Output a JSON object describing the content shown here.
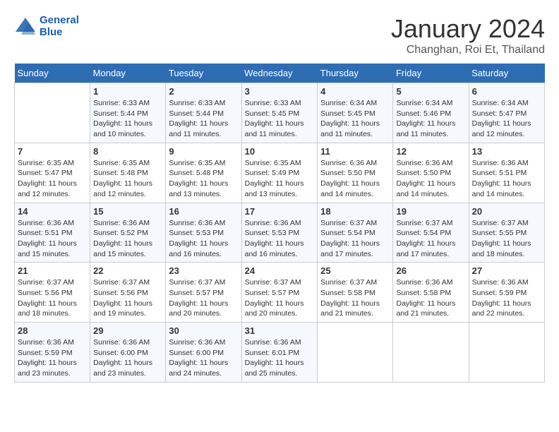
{
  "header": {
    "logo_line1": "General",
    "logo_line2": "Blue",
    "month": "January 2024",
    "location": "Changhan, Roi Et, Thailand"
  },
  "weekdays": [
    "Sunday",
    "Monday",
    "Tuesday",
    "Wednesday",
    "Thursday",
    "Friday",
    "Saturday"
  ],
  "weeks": [
    [
      {
        "num": "",
        "info": ""
      },
      {
        "num": "1",
        "info": "Sunrise: 6:33 AM\nSunset: 5:44 PM\nDaylight: 11 hours\nand 10 minutes."
      },
      {
        "num": "2",
        "info": "Sunrise: 6:33 AM\nSunset: 5:44 PM\nDaylight: 11 hours\nand 11 minutes."
      },
      {
        "num": "3",
        "info": "Sunrise: 6:33 AM\nSunset: 5:45 PM\nDaylight: 11 hours\nand 11 minutes."
      },
      {
        "num": "4",
        "info": "Sunrise: 6:34 AM\nSunset: 5:45 PM\nDaylight: 11 hours\nand 11 minutes."
      },
      {
        "num": "5",
        "info": "Sunrise: 6:34 AM\nSunset: 5:46 PM\nDaylight: 11 hours\nand 11 minutes."
      },
      {
        "num": "6",
        "info": "Sunrise: 6:34 AM\nSunset: 5:47 PM\nDaylight: 11 hours\nand 12 minutes."
      }
    ],
    [
      {
        "num": "7",
        "info": "Sunrise: 6:35 AM\nSunset: 5:47 PM\nDaylight: 11 hours\nand 12 minutes."
      },
      {
        "num": "8",
        "info": "Sunrise: 6:35 AM\nSunset: 5:48 PM\nDaylight: 11 hours\nand 12 minutes."
      },
      {
        "num": "9",
        "info": "Sunrise: 6:35 AM\nSunset: 5:48 PM\nDaylight: 11 hours\nand 13 minutes."
      },
      {
        "num": "10",
        "info": "Sunrise: 6:35 AM\nSunset: 5:49 PM\nDaylight: 11 hours\nand 13 minutes."
      },
      {
        "num": "11",
        "info": "Sunrise: 6:36 AM\nSunset: 5:50 PM\nDaylight: 11 hours\nand 14 minutes."
      },
      {
        "num": "12",
        "info": "Sunrise: 6:36 AM\nSunset: 5:50 PM\nDaylight: 11 hours\nand 14 minutes."
      },
      {
        "num": "13",
        "info": "Sunrise: 6:36 AM\nSunset: 5:51 PM\nDaylight: 11 hours\nand 14 minutes."
      }
    ],
    [
      {
        "num": "14",
        "info": "Sunrise: 6:36 AM\nSunset: 5:51 PM\nDaylight: 11 hours\nand 15 minutes."
      },
      {
        "num": "15",
        "info": "Sunrise: 6:36 AM\nSunset: 5:52 PM\nDaylight: 11 hours\nand 15 minutes."
      },
      {
        "num": "16",
        "info": "Sunrise: 6:36 AM\nSunset: 5:53 PM\nDaylight: 11 hours\nand 16 minutes."
      },
      {
        "num": "17",
        "info": "Sunrise: 6:36 AM\nSunset: 5:53 PM\nDaylight: 11 hours\nand 16 minutes."
      },
      {
        "num": "18",
        "info": "Sunrise: 6:37 AM\nSunset: 5:54 PM\nDaylight: 11 hours\nand 17 minutes."
      },
      {
        "num": "19",
        "info": "Sunrise: 6:37 AM\nSunset: 5:54 PM\nDaylight: 11 hours\nand 17 minutes."
      },
      {
        "num": "20",
        "info": "Sunrise: 6:37 AM\nSunset: 5:55 PM\nDaylight: 11 hours\nand 18 minutes."
      }
    ],
    [
      {
        "num": "21",
        "info": "Sunrise: 6:37 AM\nSunset: 5:56 PM\nDaylight: 11 hours\nand 18 minutes."
      },
      {
        "num": "22",
        "info": "Sunrise: 6:37 AM\nSunset: 5:56 PM\nDaylight: 11 hours\nand 19 minutes."
      },
      {
        "num": "23",
        "info": "Sunrise: 6:37 AM\nSunset: 5:57 PM\nDaylight: 11 hours\nand 20 minutes."
      },
      {
        "num": "24",
        "info": "Sunrise: 6:37 AM\nSunset: 5:57 PM\nDaylight: 11 hours\nand 20 minutes."
      },
      {
        "num": "25",
        "info": "Sunrise: 6:37 AM\nSunset: 5:58 PM\nDaylight: 11 hours\nand 21 minutes."
      },
      {
        "num": "26",
        "info": "Sunrise: 6:36 AM\nSunset: 5:58 PM\nDaylight: 11 hours\nand 21 minutes."
      },
      {
        "num": "27",
        "info": "Sunrise: 6:36 AM\nSunset: 5:59 PM\nDaylight: 11 hours\nand 22 minutes."
      }
    ],
    [
      {
        "num": "28",
        "info": "Sunrise: 6:36 AM\nSunset: 5:59 PM\nDaylight: 11 hours\nand 23 minutes."
      },
      {
        "num": "29",
        "info": "Sunrise: 6:36 AM\nSunset: 6:00 PM\nDaylight: 11 hours\nand 23 minutes."
      },
      {
        "num": "30",
        "info": "Sunrise: 6:36 AM\nSunset: 6:00 PM\nDaylight: 11 hours\nand 24 minutes."
      },
      {
        "num": "31",
        "info": "Sunrise: 6:36 AM\nSunset: 6:01 PM\nDaylight: 11 hours\nand 25 minutes."
      },
      {
        "num": "",
        "info": ""
      },
      {
        "num": "",
        "info": ""
      },
      {
        "num": "",
        "info": ""
      }
    ]
  ]
}
